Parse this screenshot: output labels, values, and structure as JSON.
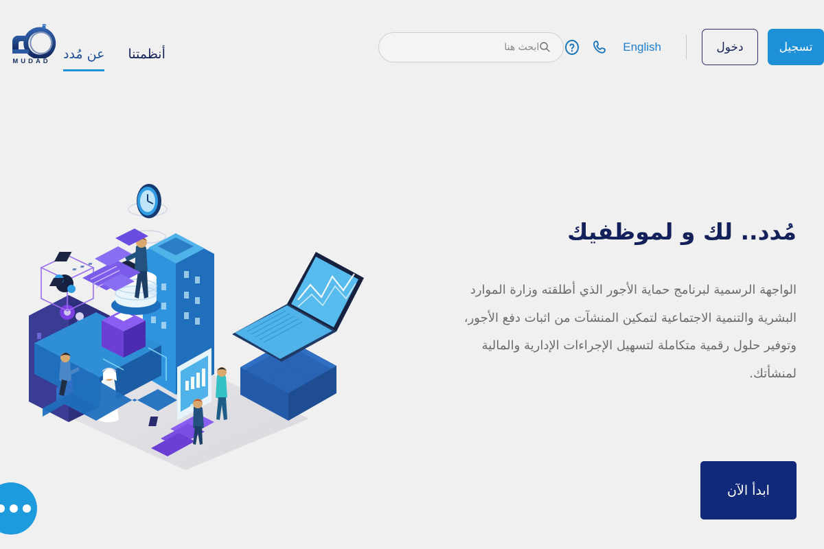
{
  "header": {
    "logo": {
      "name": "mudad-logo",
      "wordmark": "MUDAD",
      "arabic": "مُدد"
    },
    "nav": [
      {
        "label": "عن مُدد",
        "active": true
      },
      {
        "label": "أنظمتنا",
        "active": false
      }
    ],
    "search": {
      "placeholder": "ابحث هنا",
      "value": "",
      "icon": "search-icon"
    },
    "icons": [
      {
        "name": "help-circle-icon",
        "glyph": "?"
      },
      {
        "name": "phone-icon",
        "glyph": "phone"
      }
    ],
    "language_link": "English",
    "login_label": "دخول",
    "register_label": "تسجيل"
  },
  "hero": {
    "title": "مُدد.. لك و لموظفيك",
    "description": "الواجهة الرسمية لبرنامج حماية الأجور الذي أطلقته وزارة الموارد البشرية والتنمية الاجتماعية لتمكين المنشآت من اثبات دفع الأجور، وتوفير حلول رقمية متكاملة لتسهيل الإجراءات الإدارية والمالية لمنشأتك.",
    "cta_label": "ابدأ الآن"
  },
  "illustration": {
    "name": "isometric-city-illustration",
    "alt": "رسم توضيحي أيزومتري لمدينة رقمية"
  },
  "chat": {
    "name": "chat-widget",
    "dots": 3
  },
  "colors": {
    "page_bg": "#f0f0f0",
    "brand_blue": "#1e90d8",
    "navy": "#14205a",
    "cta_navy": "#102a79",
    "text_gray": "#6b6b6b",
    "link_blue": "#1e7fd0"
  }
}
